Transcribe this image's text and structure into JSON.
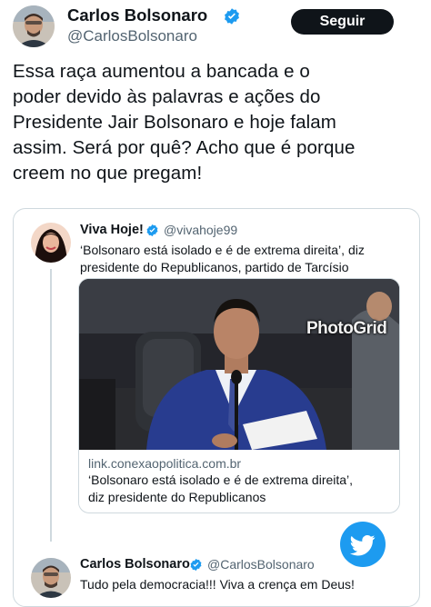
{
  "main_tweet": {
    "author_name": "Carlos Bolsonaro",
    "author_handle": "@CarlosBolsonaro",
    "follow_label": "Seguir",
    "text_lines": [
      "Essa raça aumentou a bancada e o",
      "poder devido às palavras e ações do",
      "Presidente Jair Bolsonaro e hoje falam",
      "assim. Será por quê? Acho que é porque",
      "creem no que pregam!"
    ]
  },
  "quoted_tweet": {
    "author_name": "Viva Hoje!",
    "author_handle": "@vivahoje99",
    "text_lines": [
      "‘Bolsonaro está isolado e é de extrema direita’, diz",
      "presidente do Republicanos, partido de Tarcísio"
    ],
    "image_watermark": "PhotoGrid",
    "link_card": {
      "domain": "link.conexaopolitica.com.br",
      "title_lines": [
        "‘Bolsonaro está isolado e é de extrema direita’,",
        "diz presidente do Republicanos"
      ]
    }
  },
  "reply_tweet": {
    "author_name": "Carlos Bolsonaro",
    "author_handle": "@CarlosBolsonaro",
    "text": "Tudo pela democracia!!! Viva a crença em Deus!"
  },
  "icons": {
    "verified": "verified-badge-icon",
    "twitter": "twitter-bird-icon"
  },
  "colors": {
    "twitter_blue": "#1d9bf0",
    "text_primary": "#0f1419",
    "text_secondary": "#536471",
    "button_bg": "#0f1419",
    "border": "#cfd9de"
  }
}
